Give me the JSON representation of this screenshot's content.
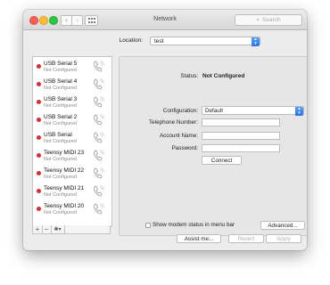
{
  "window": {
    "title": "Network",
    "search_placeholder": "Search",
    "nav_back": "‹",
    "nav_forward": "›"
  },
  "location": {
    "label": "Location:",
    "value": "test"
  },
  "services": [
    {
      "name": "USB Serial 5",
      "status": "Not Configured"
    },
    {
      "name": "USB Serial 4",
      "status": "Not Configured"
    },
    {
      "name": "USB Serial 3",
      "status": "Not Configured"
    },
    {
      "name": "USB Serial 2",
      "status": "Not Configured"
    },
    {
      "name": "USB Serial",
      "status": "Not Configured"
    },
    {
      "name": "Teensy MIDI 23",
      "status": "Not Configured"
    },
    {
      "name": "Teensy MIDI 22",
      "status": "Not Configured"
    },
    {
      "name": "Teensy MIDI 21",
      "status": "Not Configured"
    },
    {
      "name": "Teensy MIDI 20",
      "status": "Not Configured"
    }
  ],
  "sidebar_tools": {
    "add": "+",
    "remove": "−",
    "gear": "✱▾"
  },
  "detail": {
    "status_label": "Status:",
    "status_value": "Not Configured",
    "configuration_label": "Configuration:",
    "configuration_value": "Default",
    "telephone_label": "Telephone Number:",
    "account_label": "Account Name:",
    "password_label": "Password:",
    "connect_button": "Connect",
    "modem_checkbox_label": "Show modem status in menu bar",
    "advanced_button": "Advanced...",
    "help_button": "?"
  },
  "footer": {
    "assist_button": "Assist me...",
    "revert_button": "Revert",
    "apply_button": "Apply"
  },
  "colors": {
    "status_dot": "#e12a2a",
    "accent": "#2b74e6"
  }
}
